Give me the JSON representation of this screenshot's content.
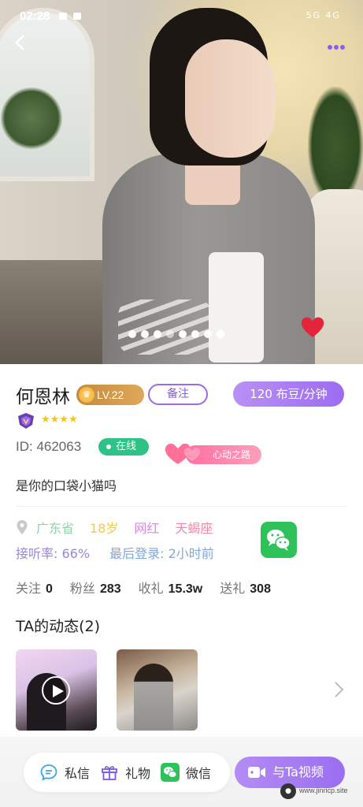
{
  "status_bar": {
    "time": "02:28",
    "signal_text": "5G 4G"
  },
  "profile": {
    "name": "何恩林",
    "level": "LV.22",
    "remark_label": "备注",
    "price_label": "120 布豆/分钟",
    "stars": "★★★★",
    "id_text": "ID: 462063",
    "online_label": "在线",
    "heart_badge_label": "心动之路",
    "bio": "是你的口袋小猫吗",
    "tags": {
      "province": "广东省",
      "age": "18岁",
      "type": "网红",
      "zodiac": "天蝎座"
    },
    "answer_rate": "接听率: 66%",
    "last_login": "最后登录: 2小时前",
    "follows": [
      {
        "label": "关注",
        "value": "0"
      },
      {
        "label": "粉丝",
        "value": "283"
      },
      {
        "label": "收礼",
        "value": "15.3w"
      },
      {
        "label": "送礼",
        "value": "308"
      }
    ]
  },
  "moments": {
    "title": "TA的动态(2)"
  },
  "carousel": {
    "count": 8,
    "active_index": 3
  },
  "bottom_bar": {
    "message_label": "私信",
    "gift_label": "礼物",
    "wechat_label": "微信",
    "video_label": "与Ta视频"
  },
  "watermark": {
    "text": "www.jinricp.site"
  },
  "colors": {
    "accent": "#9c6cf0",
    "online": "#2ec286",
    "wechat": "#2fc15a",
    "heart": "#e3243b"
  }
}
